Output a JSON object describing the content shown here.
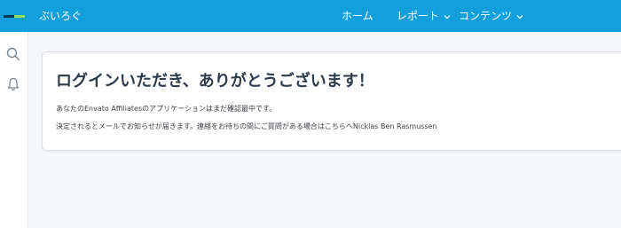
{
  "header": {
    "brand": "ぶいろぐ",
    "nav": {
      "home": "ホーム",
      "report": "レポート",
      "content": "コンテンツ"
    }
  },
  "sidebar": {
    "icons": [
      "search-icon",
      "bell-icon"
    ]
  },
  "card": {
    "title": "ログインいただき、ありがとうございます！",
    "line1": "あなたのEnvato Affiliatesのアプリケーションはまだ確認最中です。",
    "line2": "決定されるとメールでお知らせが届きます。連絡をお待ちの間にご質問がある場合はこちらへNicklas Ben Rasmussen"
  },
  "colors": {
    "header": "#139fdc",
    "background": "#f5f7fa",
    "title": "#2d3b4a"
  }
}
